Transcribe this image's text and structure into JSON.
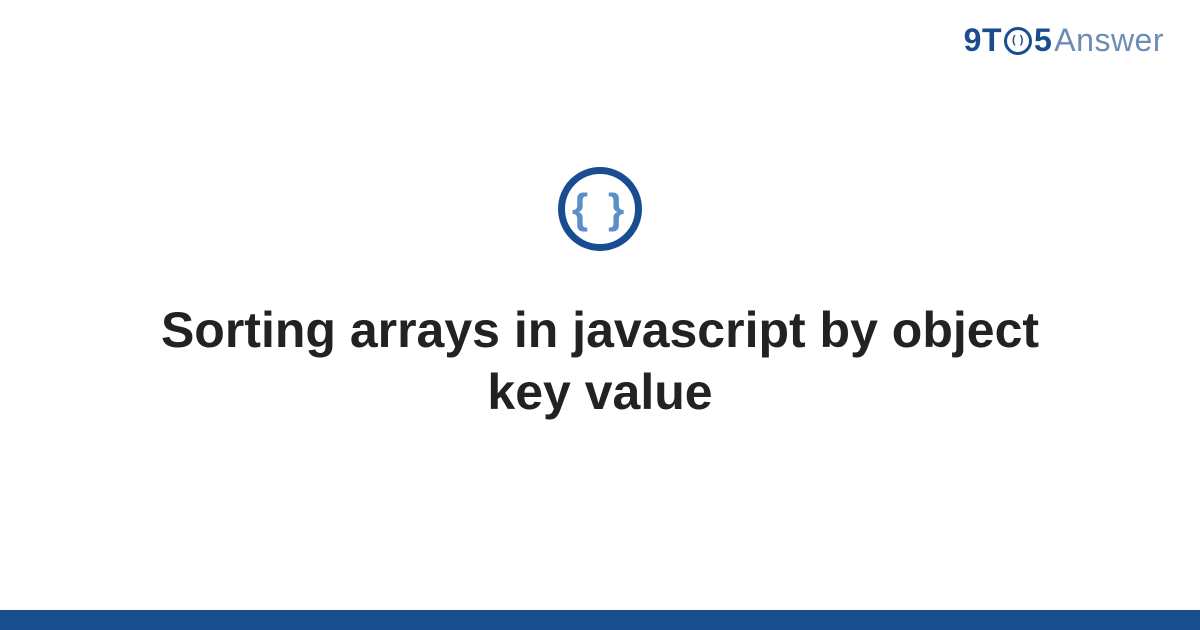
{
  "brand": {
    "part_9t": "9T",
    "part_5": "5",
    "part_answer": "Answer",
    "clock_glyph": "⏱"
  },
  "topic": {
    "icon_glyph": "{ }",
    "icon_name": "braces-icon"
  },
  "title": "Sorting arrays in javascript by object key value"
}
